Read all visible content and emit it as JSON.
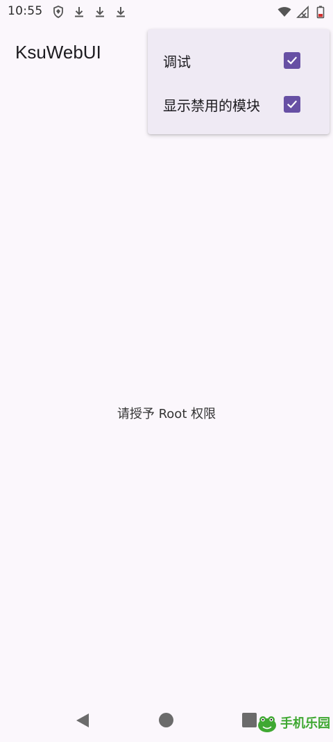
{
  "status_bar": {
    "time": "10:55",
    "left_icons": [
      "shield-icon",
      "download-icon",
      "download-icon",
      "download-icon"
    ],
    "right_icons": [
      "wifi-icon",
      "signal-icon",
      "battery-icon"
    ]
  },
  "app_bar": {
    "title": "KsuWebUI"
  },
  "menu": {
    "items": [
      {
        "label": "调试",
        "checked": true
      },
      {
        "label": "显示禁用的模块",
        "checked": true
      }
    ]
  },
  "main": {
    "message": "请授予 Root 权限"
  },
  "watermark": {
    "text": "手机乐园"
  },
  "colors": {
    "background": "#FBF7FC",
    "menu_background": "#EFEAF4",
    "checkbox": "#6750A4",
    "watermark": "#3FA832"
  }
}
